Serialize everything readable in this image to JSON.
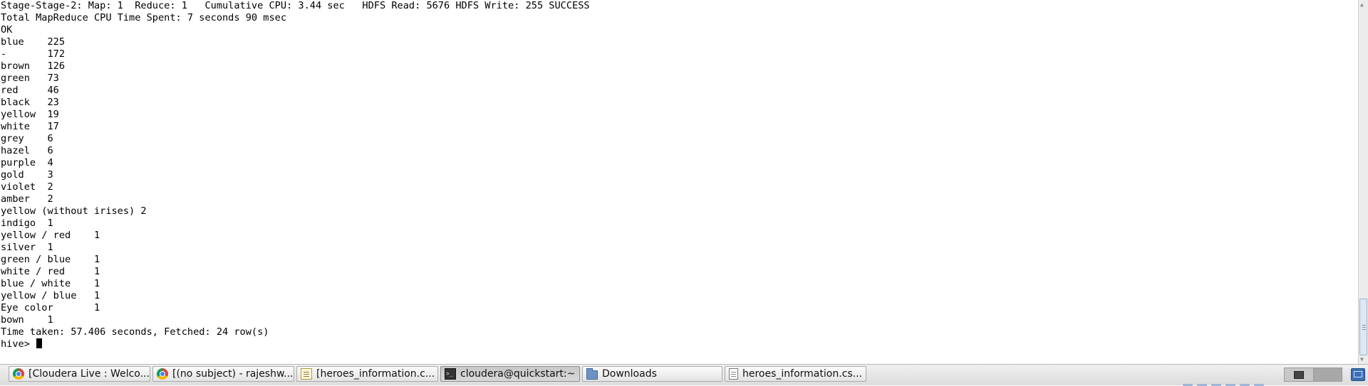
{
  "terminal": {
    "lines": [
      "Stage-Stage-2: Map: 1  Reduce: 1   Cumulative CPU: 3.44 sec   HDFS Read: 5676 HDFS Write: 255 SUCCESS",
      "Total MapReduce CPU Time Spent: 7 seconds 90 msec",
      "OK",
      "blue    225",
      "-       172",
      "brown   126",
      "green   73",
      "red     46",
      "black   23",
      "yellow  19",
      "white   17",
      "grey    6",
      "hazel   6",
      "purple  4",
      "gold    3",
      "violet  2",
      "amber   2",
      "yellow (without irises) 2",
      "indigo  1",
      "yellow / red    1",
      "silver  1",
      "green / blue    1",
      "white / red     1",
      "blue / white    1",
      "yellow / blue   1",
      "Eye color       1",
      "bown    1",
      "Time taken: 57.406 seconds, Fetched: 24 row(s)"
    ],
    "prompt": "hive> "
  },
  "taskbar": {
    "tasks": [
      {
        "label": "[Cloudera Live : Welco...",
        "icon": "chrome-icon"
      },
      {
        "label": "[(no subject) - rajeshw...",
        "icon": "chrome-icon"
      },
      {
        "label": "[heroes_information.c...",
        "icon": "text-editor-icon"
      },
      {
        "label": "cloudera@quickstart:~",
        "icon": "terminal-icon"
      },
      {
        "label": "Downloads",
        "icon": "folder-icon"
      },
      {
        "label": "heroes_information.cs...",
        "icon": "document-icon"
      }
    ]
  }
}
